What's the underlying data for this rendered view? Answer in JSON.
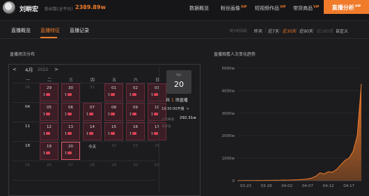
{
  "header": {
    "user_name": "刘畊宏",
    "fans_label": "粉丝数(全平台)",
    "fans_value": "2389.89w",
    "nav": [
      {
        "label": "数据概览",
        "vip": ""
      },
      {
        "label": "粉丝画像",
        "vip": "VIP"
      },
      {
        "label": "短视频作品",
        "vip": "VIP"
      },
      {
        "label": "带货商品",
        "vip": "VIP"
      }
    ],
    "nav_active": {
      "label": "直播分析",
      "vip": "VIP"
    }
  },
  "subnav": {
    "tabs": [
      "直播概览",
      "直播特征",
      "直播记录"
    ],
    "active_tab": "直播特征",
    "range_label": "统计时间段",
    "ranges": [
      "昨天",
      "近7天",
      "近30天",
      "近90天",
      "近180天",
      "自定义"
    ],
    "active_range": "近30天"
  },
  "calendar": {
    "title": "直播场次分布",
    "month": "4月",
    "year": "2022",
    "prev": "<",
    "next": ">",
    "weekdays": [
      "一",
      "二",
      "三",
      "四",
      "五",
      "六",
      "日"
    ],
    "rows": [
      [
        {
          "d": "28",
          "c": "",
          "dim": true
        },
        {
          "d": "29",
          "c": "1",
          "hl": true
        },
        {
          "d": "30",
          "c": "1",
          "hl": true
        },
        {
          "d": "31",
          "c": "",
          "dim": true
        },
        {
          "d": "01",
          "c": "1",
          "hl": true
        },
        {
          "d": "02",
          "c": "1",
          "hl": true
        },
        {
          "d": "03",
          "c": "1",
          "hl": true
        }
      ],
      [
        {
          "d": "04",
          "c": ""
        },
        {
          "d": "05",
          "c": "1",
          "hl": true
        },
        {
          "d": "06",
          "c": "1",
          "hl": true
        },
        {
          "d": "07",
          "c": "1",
          "hl": true
        },
        {
          "d": "08",
          "c": "1",
          "hl": true
        },
        {
          "d": "09",
          "c": "1",
          "hl": true
        },
        {
          "d": "10",
          "c": "1",
          "hl": true
        }
      ],
      [
        {
          "d": "11",
          "c": ""
        },
        {
          "d": "12",
          "c": "1",
          "hl": true
        },
        {
          "d": "13",
          "c": "1",
          "hl": true
        },
        {
          "d": "14",
          "c": "1",
          "hl": true
        },
        {
          "d": "15",
          "c": "1",
          "hl": true
        },
        {
          "d": "16",
          "c": "1",
          "hl": true
        },
        {
          "d": "17",
          "c": "1",
          "hl": true
        }
      ],
      [
        {
          "d": "18",
          "c": ""
        },
        {
          "d": "19",
          "c": "1",
          "hl": true
        },
        {
          "d": "20",
          "c": "1",
          "hl": true,
          "today": true
        },
        {
          "d": "今天",
          "c": ""
        },
        {
          "d": "22",
          "c": "",
          "dim": true
        },
        {
          "d": "23",
          "c": "",
          "dim": true
        },
        {
          "d": "24",
          "c": "",
          "dim": true
        }
      ],
      [
        {
          "d": "25",
          "c": "",
          "dim": true
        },
        {
          "d": "26",
          "c": "",
          "dim": true
        },
        {
          "d": "27",
          "c": "",
          "dim": true
        },
        {
          "d": "28",
          "c": "",
          "dim": true
        },
        {
          "d": "29",
          "c": "",
          "dim": true
        },
        {
          "d": "30",
          "c": "",
          "dim": true
        },
        {
          "d": "01",
          "c": "",
          "dim": true
        }
      ]
    ],
    "detail": {
      "month": "Apr",
      "day": "20",
      "count_prefix": "共",
      "count": "1",
      "count_suffix": "场直播",
      "time": "19:30:00开播",
      "time_arrow": ">",
      "pop_label": "人气峰值",
      "pop_value": "292.31w",
      "extra": "未开放"
    }
  },
  "chart_data": {
    "type": "area",
    "title": "直播观看人次变化趋势",
    "xlabel": "",
    "ylabel": "",
    "x": [
      "03-21",
      "03-22",
      "03-23",
      "03-24",
      "03-25",
      "03-26",
      "03-27",
      "03-28",
      "03-29",
      "03-30",
      "03-31",
      "04-01",
      "04-02",
      "04-03",
      "04-04",
      "04-05",
      "04-06",
      "04-07",
      "04-08",
      "04-09",
      "04-10",
      "04-11",
      "04-12",
      "04-13",
      "04-14",
      "04-15",
      "04-16",
      "04-17",
      "04-18",
      "04-19",
      "04-20"
    ],
    "x_ticks": [
      "03-23",
      "03-28",
      "04-02",
      "04-07",
      "04-12",
      "04-17"
    ],
    "y_ticks": [
      "0",
      "1000w",
      "2000w",
      "3000w",
      "4000w",
      "5000w"
    ],
    "ylim": [
      0,
      5000
    ],
    "unit": "w",
    "values": [
      5,
      8,
      10,
      12,
      10,
      15,
      12,
      20,
      15,
      25,
      20,
      30,
      25,
      35,
      40,
      45,
      60,
      80,
      120,
      200,
      350,
      300,
      400,
      380,
      500,
      700,
      900,
      1000,
      1300,
      2000,
      4300
    ],
    "color": "#f07b2b"
  }
}
